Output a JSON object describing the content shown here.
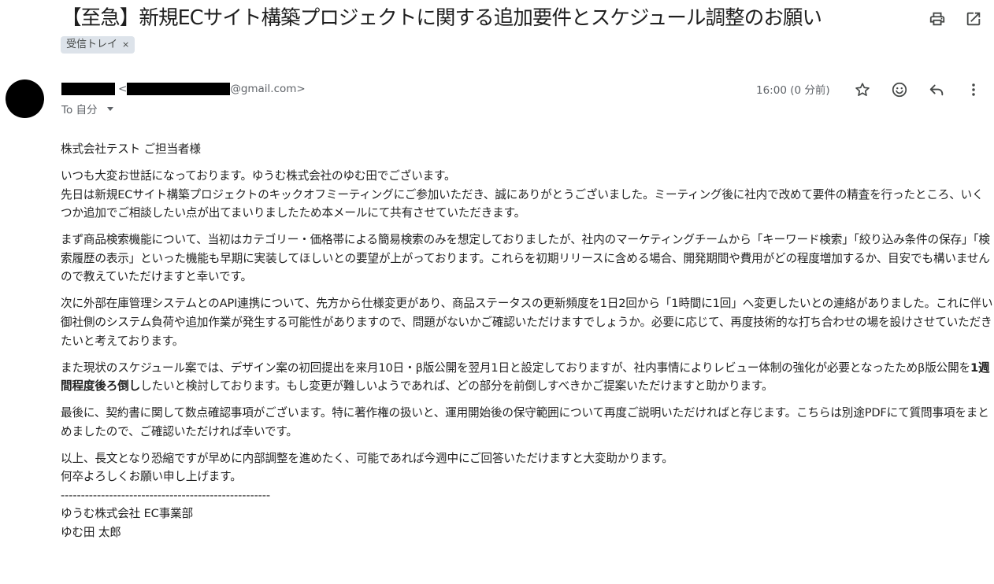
{
  "email": {
    "subject": "【至急】新規ECサイト構築プロジェクトに関する追加要件とスケジュール調整のお願い",
    "label": "受信トレイ",
    "label_remove": "×",
    "sender_open": "<",
    "sender_email_domain": "@gmail.com>",
    "to": "To 自分",
    "time": "16:00 (0 分前)",
    "greeting": "株式会社テスト ご担当者様",
    "p1": [
      "いつも大変お世話になっております。ゆうむ株式会社のゆむ田でございます。",
      "先日は新規ECサイト構築プロジェクトのキックオフミーティングにご参加いただき、誠にありがとうございました。ミーティング後に社内で改めて要件の精査を行ったところ、いくつか追加でご相談したい点が出てまいりましたため本メールにて共有させていただきます。"
    ],
    "p2": "まず商品検索機能について、当初はカテゴリー・価格帯による簡易検索のみを想定しておりましたが、社内のマーケティングチームから「キーワード検索」「絞り込み条件の保存」「検索履歴の表示」といった機能も早期に実装してほしいとの要望が上がっております。これらを初期リリースに含める場合、開発期間や費用がどの程度増加するか、目安でも構いませんので教えていただけますと幸いです。",
    "p3": "次に外部在庫管理システムとのAPI連携について、先方から仕様変更があり、商品ステータスの更新頻度を1日2回から「1時間に1回」へ変更したいとの連絡がありました。これに伴い御社側のシステム負荷や追加作業が発生する可能性がありますので、問題がないかご確認いただけますでしょうか。必要に応じて、再度技術的な打ち合わせの場を設けさせていただきたいと考えております。",
    "p4_before": "また現状のスケジュール案では、デザイン案の初回提出を来月10日・β版公開を翌月1日と設定しておりますが、社内事情によりレビュー体制の強化が必要となったためβ版公開を",
    "p4_bold": "1週間程度後ろ倒し",
    "p4_after": "したいと検討しております。もし変更が難しいようであれば、どの部分を前倒しすべきかご提案いただけますと助かります。",
    "p5": "最後に、契約書に関して数点確認事項がございます。特に著作権の扱いと、運用開始後の保守範囲について再度ご説明いただければと存じます。こちらは別途PDFにて質問事項をまとめましたので、ご確認いただければ幸いです。",
    "p6": [
      "以上、長文となり恐縮ですが早めに内部調整を進めたく、可能であれば今週中にご回答いただけますと大変助かります。",
      "何卒よろしくお願い申し上げます。"
    ],
    "signature": [
      "----------------------------------------------------",
      "ゆうむ株式会社  EC事業部",
      "ゆむ田 太郎"
    ]
  },
  "icons": {
    "print": "print-icon",
    "open_new": "open-in-new-window-icon",
    "star": "star-icon",
    "emoji": "emoji-icon",
    "reply": "reply-icon",
    "more": "more-vert-icon"
  }
}
